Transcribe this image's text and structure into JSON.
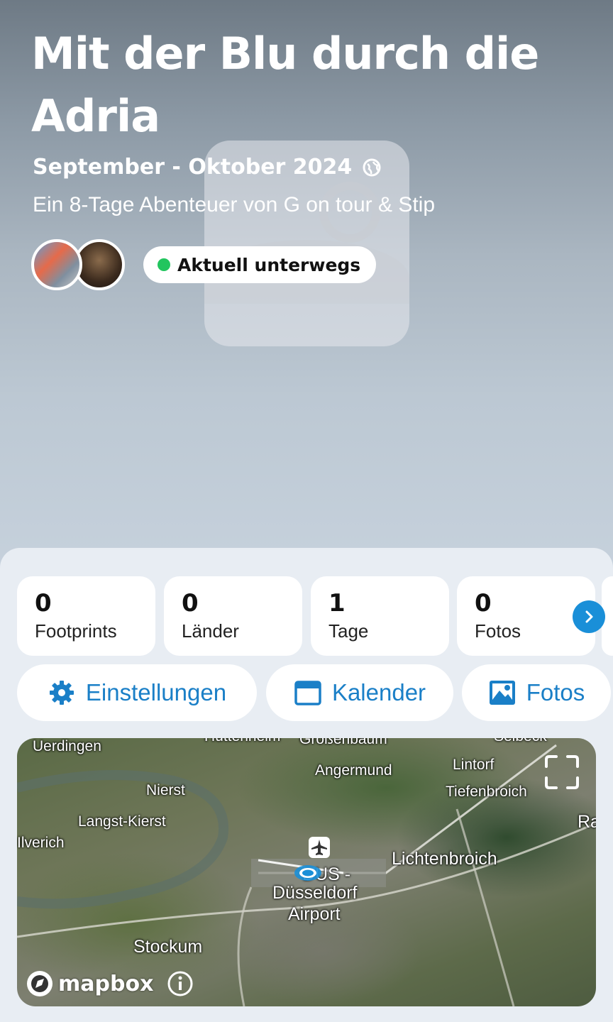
{
  "trip": {
    "title": "Mit der Blu durch die Adria",
    "dates": "September - Oktober 2024",
    "subtitle": "Ein 8-Tage Abenteuer von G on tour & Stip",
    "status": "Aktuell unterwegs"
  },
  "stats": [
    {
      "value": "0",
      "label": "Footprints"
    },
    {
      "value": "0",
      "label": "Länder"
    },
    {
      "value": "1",
      "label": "Tage"
    },
    {
      "value": "0",
      "label": "Fotos"
    }
  ],
  "actions": {
    "settings": "Einstellungen",
    "calendar": "Kalender",
    "photos": "Fotos"
  },
  "map": {
    "places": {
      "uerdingen": "Uerdingen",
      "huettenheim": "Hüttenheim",
      "grossenbaum": "Großenbaum",
      "selbeck": "Selbeck",
      "angermund": "Angermund",
      "lintorf": "Lintorf",
      "nierst": "Nierst",
      "tiefenbroich": "Tiefenbroich",
      "langst": "Langst-Kierst",
      "ra": "Ra",
      "ilverich": "Ilverich",
      "lichtenbroich": "Lichtenbroich",
      "airport_line1": "DUS -",
      "airport_line2": "Düsseldorf",
      "airport_line3": "Airport",
      "stockum": "Stockum"
    },
    "attribution": "mapbox"
  },
  "colors": {
    "accent": "#1a7fc7",
    "status_dot": "#22c55e"
  }
}
